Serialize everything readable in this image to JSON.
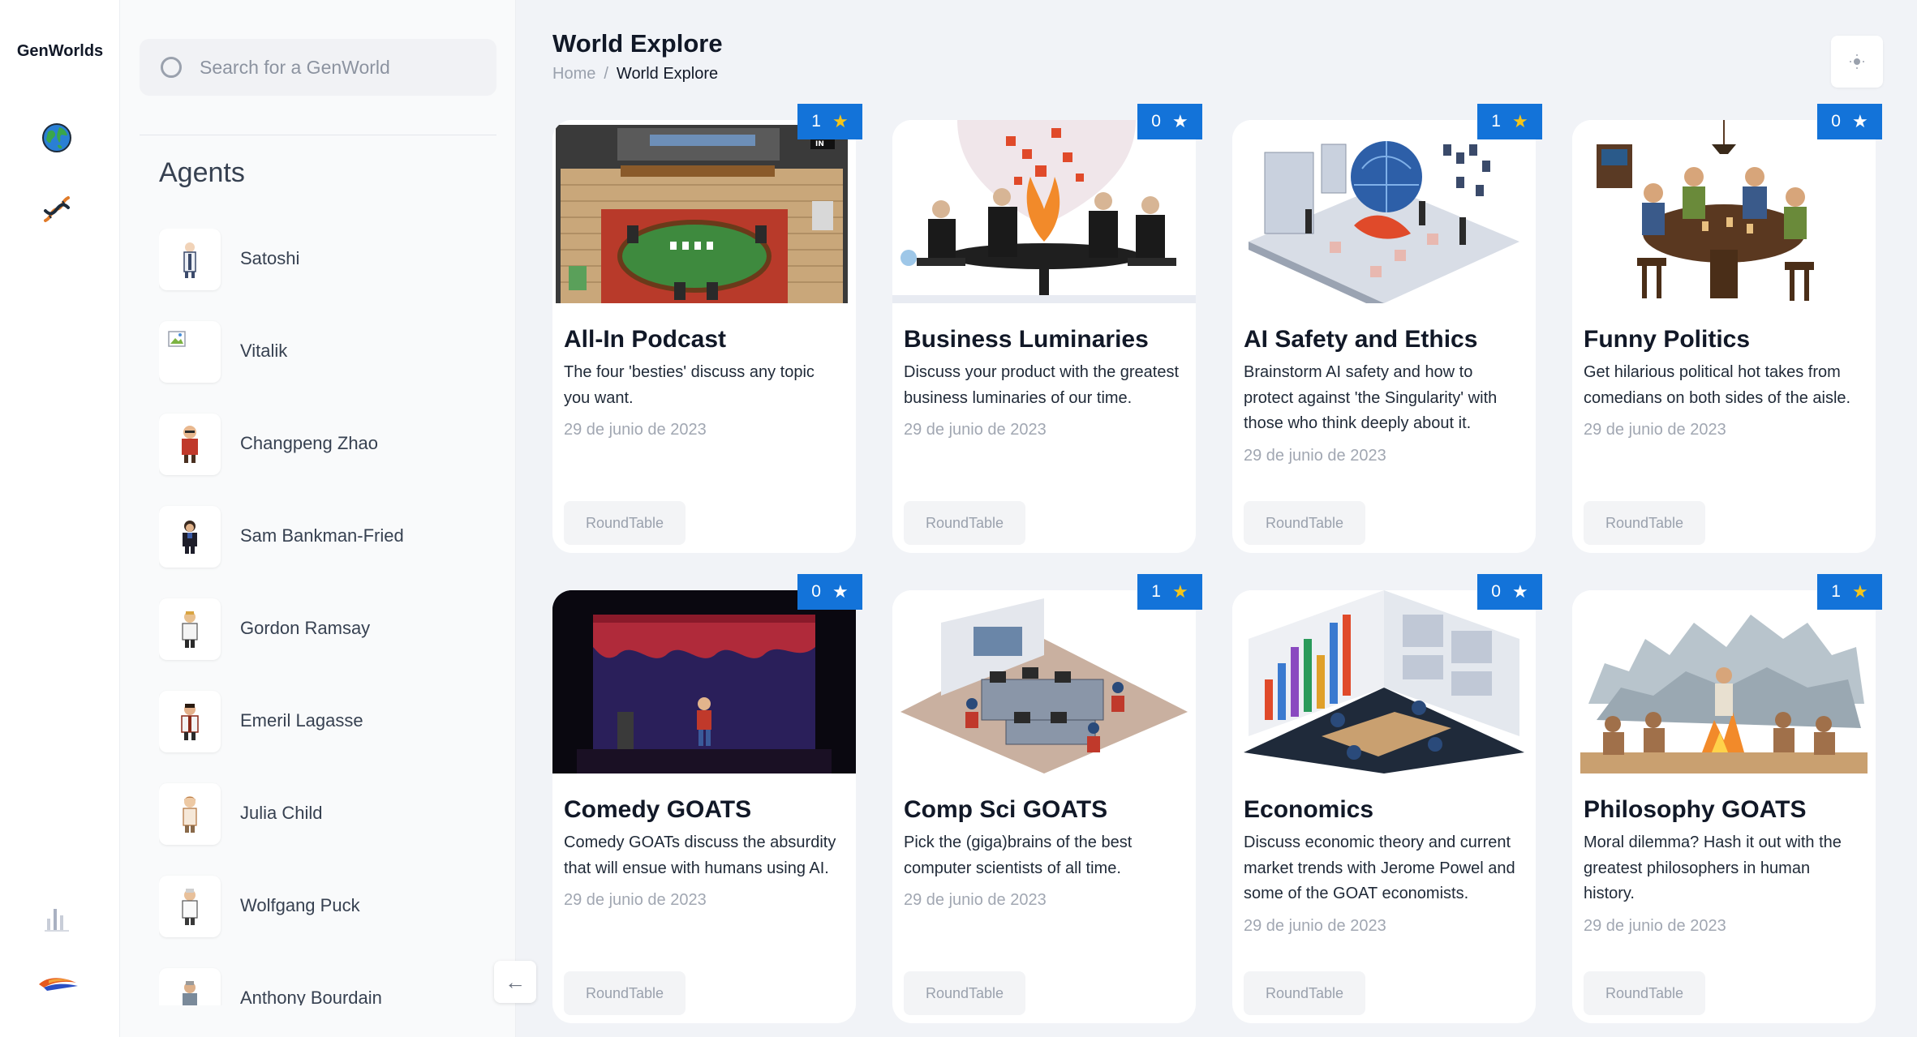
{
  "app": {
    "name": "GenWorlds"
  },
  "search": {
    "placeholder": "Search for a GenWorld"
  },
  "agents_panel": {
    "title": "Agents",
    "items": [
      {
        "name": "Satoshi"
      },
      {
        "name": "Vitalik"
      },
      {
        "name": "Changpeng Zhao"
      },
      {
        "name": "Sam Bankman-Fried"
      },
      {
        "name": "Gordon Ramsay"
      },
      {
        "name": "Emeril Lagasse"
      },
      {
        "name": "Julia Child"
      },
      {
        "name": "Wolfgang Puck"
      },
      {
        "name": "Anthony Bourdain"
      }
    ]
  },
  "rail_icons": [
    "globe-icon",
    "dna-icon",
    "bar-chart-icon",
    "logo-mark-icon"
  ],
  "header": {
    "title": "World Explore",
    "breadcrumb": {
      "home": "Home",
      "separator": "/",
      "current": "World Explore"
    }
  },
  "worlds": [
    {
      "title": "All-In Podcast",
      "description": "The four 'besties' discuss any topic you want.",
      "date": "29 de junio de 2023",
      "rating": "1",
      "tag": "RoundTable"
    },
    {
      "title": "Business Luminaries",
      "description": "Discuss your product with the greatest business luminaries of our time.",
      "date": "29 de junio de 2023",
      "rating": "0",
      "tag": "RoundTable"
    },
    {
      "title": "AI Safety and Ethics",
      "description": "Brainstorm AI safety and how to protect against 'the Singularity' with those who think deeply about it.",
      "date": "29 de junio de 2023",
      "rating": "1",
      "tag": "RoundTable"
    },
    {
      "title": "Funny Politics",
      "description": "Get hilarious political hot takes from comedians on both sides of the aisle.",
      "date": "29 de junio de 2023",
      "rating": "0",
      "tag": "RoundTable"
    },
    {
      "title": "Comedy GOATS",
      "description": "Comedy GOATs discuss the absurdity that will ensue with humans using AI.",
      "date": "29 de junio de 2023",
      "rating": "0",
      "tag": "RoundTable"
    },
    {
      "title": "Comp Sci GOATS",
      "description": "Pick the (giga)brains of the best computer scientists of all time.",
      "date": "29 de junio de 2023",
      "rating": "1",
      "tag": "RoundTable"
    },
    {
      "title": "Economics",
      "description": "Discuss economic theory and current market trends with Jerome Powel and some of the GOAT economists.",
      "date": "29 de junio de 2023",
      "rating": "0",
      "tag": "RoundTable"
    },
    {
      "title": "Philosophy GOATS",
      "description": "Moral dilemma? Hash it out with the greatest philosophers in human history.",
      "date": "29 de junio de 2023",
      "rating": "1",
      "tag": "RoundTable"
    }
  ],
  "colors": {
    "accent": "#1373d9",
    "star": "#f5c518",
    "background": "#f1f3f7"
  }
}
